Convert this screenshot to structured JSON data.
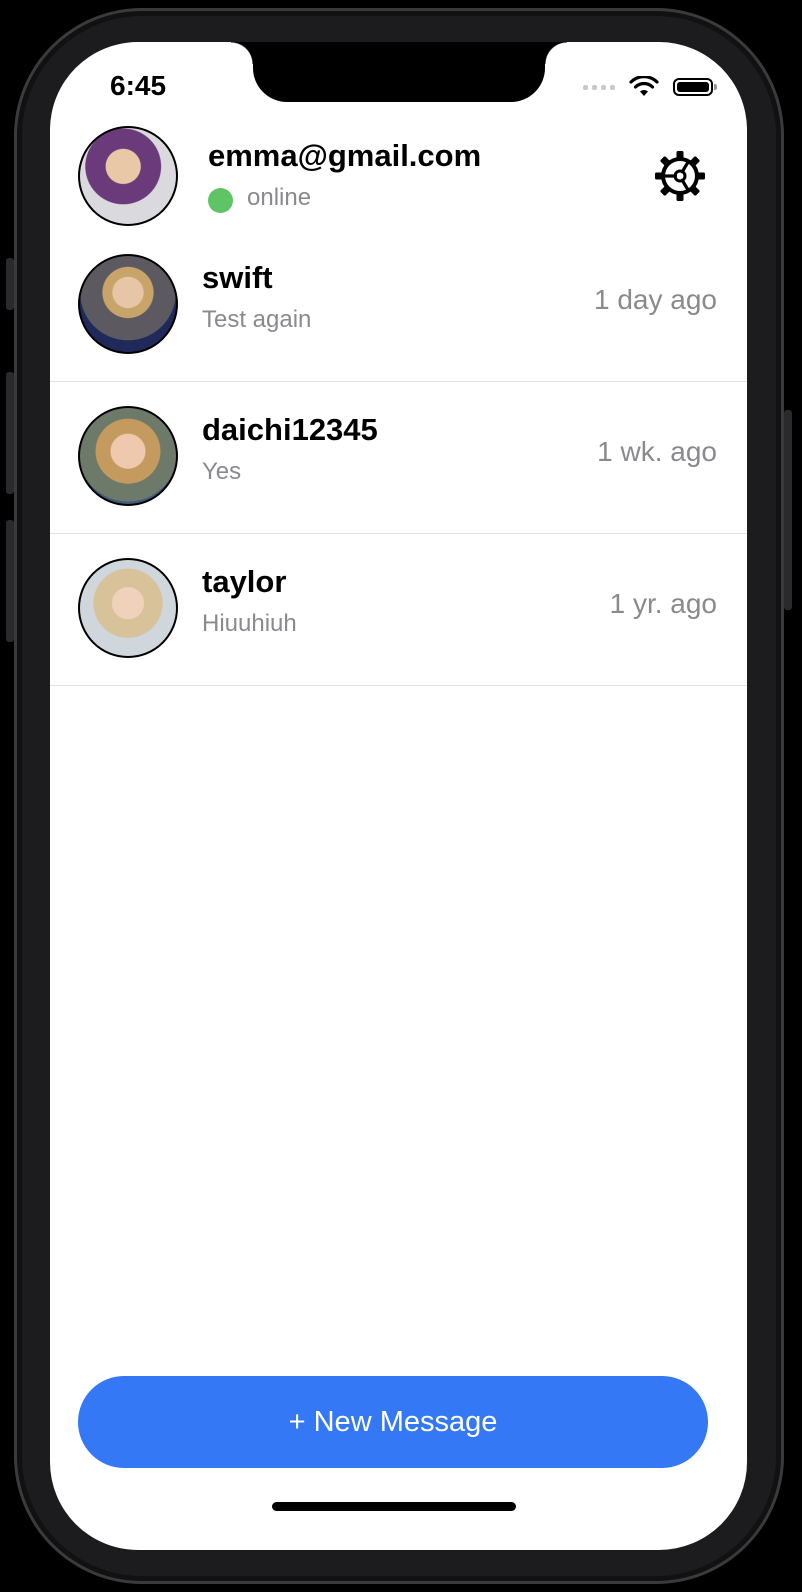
{
  "status_bar": {
    "time": "6:45",
    "wifi_icon": "wifi-icon",
    "battery_icon": "battery-icon"
  },
  "header": {
    "email": "emma@gmail.com",
    "status": "online",
    "status_color": "#5fc466",
    "settings_icon": "gear-icon"
  },
  "conversations": [
    {
      "name": "swift",
      "preview": "Test again",
      "time": "1 day ago"
    },
    {
      "name": "daichi12345",
      "preview": "Yes",
      "time": "1 wk. ago"
    },
    {
      "name": "taylor",
      "preview": "Hiuuhiuh",
      "time": "1 yr. ago"
    }
  ],
  "new_message_button": {
    "label": "+ New Message",
    "color": "#3478f6"
  }
}
